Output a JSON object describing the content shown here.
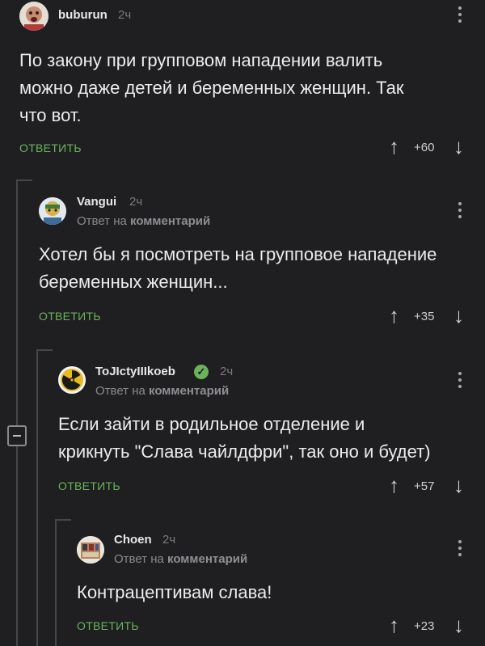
{
  "comments": [
    {
      "username": "buburun",
      "time": "2ч",
      "reply_prefix": "",
      "reply_target": "",
      "text_lines": [
        "По закону при групповом нападении валить",
        "можно даже детей и беременных женщин. Так",
        "что вот."
      ],
      "reply_label": "ОТВЕТИТЬ",
      "score": "+60"
    },
    {
      "username": "Vangui",
      "time": "2ч",
      "reply_prefix": "Ответ на",
      "reply_target": "комментарий",
      "text_lines": [
        "Хотел бы я посмотреть на групповое нападение",
        "беременных женщин..."
      ],
      "reply_label": "ОТВЕТИТЬ",
      "score": "+35"
    },
    {
      "username": "ToJIctyIIIkoeb",
      "time": "2ч",
      "reply_prefix": "Ответ на",
      "reply_target": "комментарий",
      "text_lines": [
        "Если зайти в родильное отделение и",
        "крикнуть \"Слава чайлдфри\", так оно и будет)"
      ],
      "reply_label": "ОТВЕТИТЬ",
      "score": "+57"
    },
    {
      "username": "Choen",
      "time": "2ч",
      "reply_prefix": "Ответ на",
      "reply_target": "комментарий",
      "text_lines": [
        "Контрацептивам слава!"
      ],
      "reply_label": "ОТВЕТИТЬ",
      "score": "+23"
    }
  ],
  "icons": {
    "upvote": "↑",
    "downvote": "↓",
    "verified": "✓"
  },
  "colors": {
    "background": "#1f1f21",
    "accent_green": "#6bb35b",
    "thread_line": "#47474a"
  }
}
